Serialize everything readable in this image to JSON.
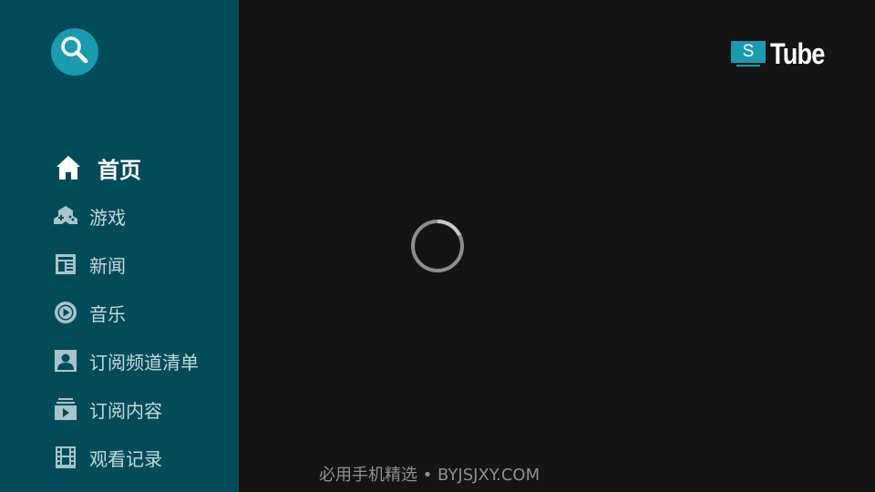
{
  "app": {
    "logo_letter": "S",
    "logo_word": "Tube"
  },
  "search": {
    "icon": "search-icon"
  },
  "sidebar": {
    "items": [
      {
        "label": "首页",
        "icon": "home-icon",
        "active": true
      },
      {
        "label": "游戏",
        "icon": "gamepad-icon",
        "active": false
      },
      {
        "label": "新闻",
        "icon": "newspaper-icon",
        "active": false
      },
      {
        "label": "音乐",
        "icon": "music-play-icon",
        "active": false
      },
      {
        "label": "订阅频道清单",
        "icon": "account-box-icon",
        "active": false
      },
      {
        "label": "订阅内容",
        "icon": "subscriptions-icon",
        "active": false
      },
      {
        "label": "观看记录",
        "icon": "film-strip-icon",
        "active": false
      }
    ]
  },
  "main": {
    "state": "loading"
  },
  "watermark": "必用手机精选 • BYJSJXY.COM",
  "colors": {
    "sidebar_bg": "#024c5a",
    "main_bg": "#141414",
    "accent": "#1a9bb0"
  }
}
